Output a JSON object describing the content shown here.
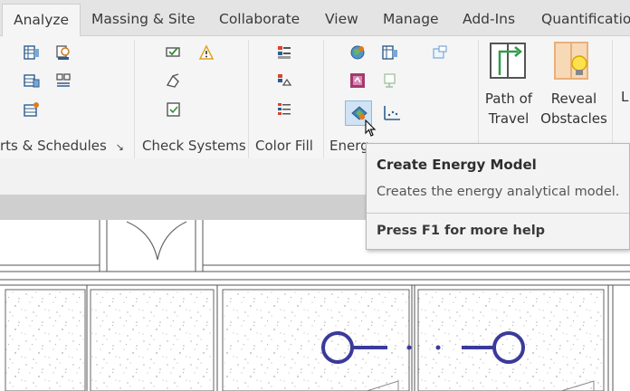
{
  "tabs": [
    {
      "label": "Analyze",
      "active": true
    },
    {
      "label": "Massing & Site"
    },
    {
      "label": "Collaborate"
    },
    {
      "label": "View"
    },
    {
      "label": "Manage"
    },
    {
      "label": "Add-Ins"
    },
    {
      "label": "Quantification"
    }
  ],
  "ribbon": {
    "panels": [
      {
        "label": "rts & Schedules",
        "launcher": "↘"
      },
      {
        "label": "Check Systems"
      },
      {
        "label": "Color Fill"
      },
      {
        "label": "Energ"
      }
    ],
    "path_of_travel": {
      "line1": "Path of",
      "line2": "Travel"
    },
    "reveal_obstacles": {
      "line1": "Reveal",
      "line2": "Obstacles"
    },
    "partial_label": "L"
  },
  "tooltip": {
    "title": "Create Energy Model",
    "description": "Creates the energy analytical model.",
    "help": "Press F1 for more help"
  },
  "colors": {
    "tab_bar": "#e4e4e4",
    "ribbon_bg": "#f5f5f5",
    "tooltip_bg": "#f3f3f3",
    "drawing_symbol": "#3b3a9a"
  }
}
